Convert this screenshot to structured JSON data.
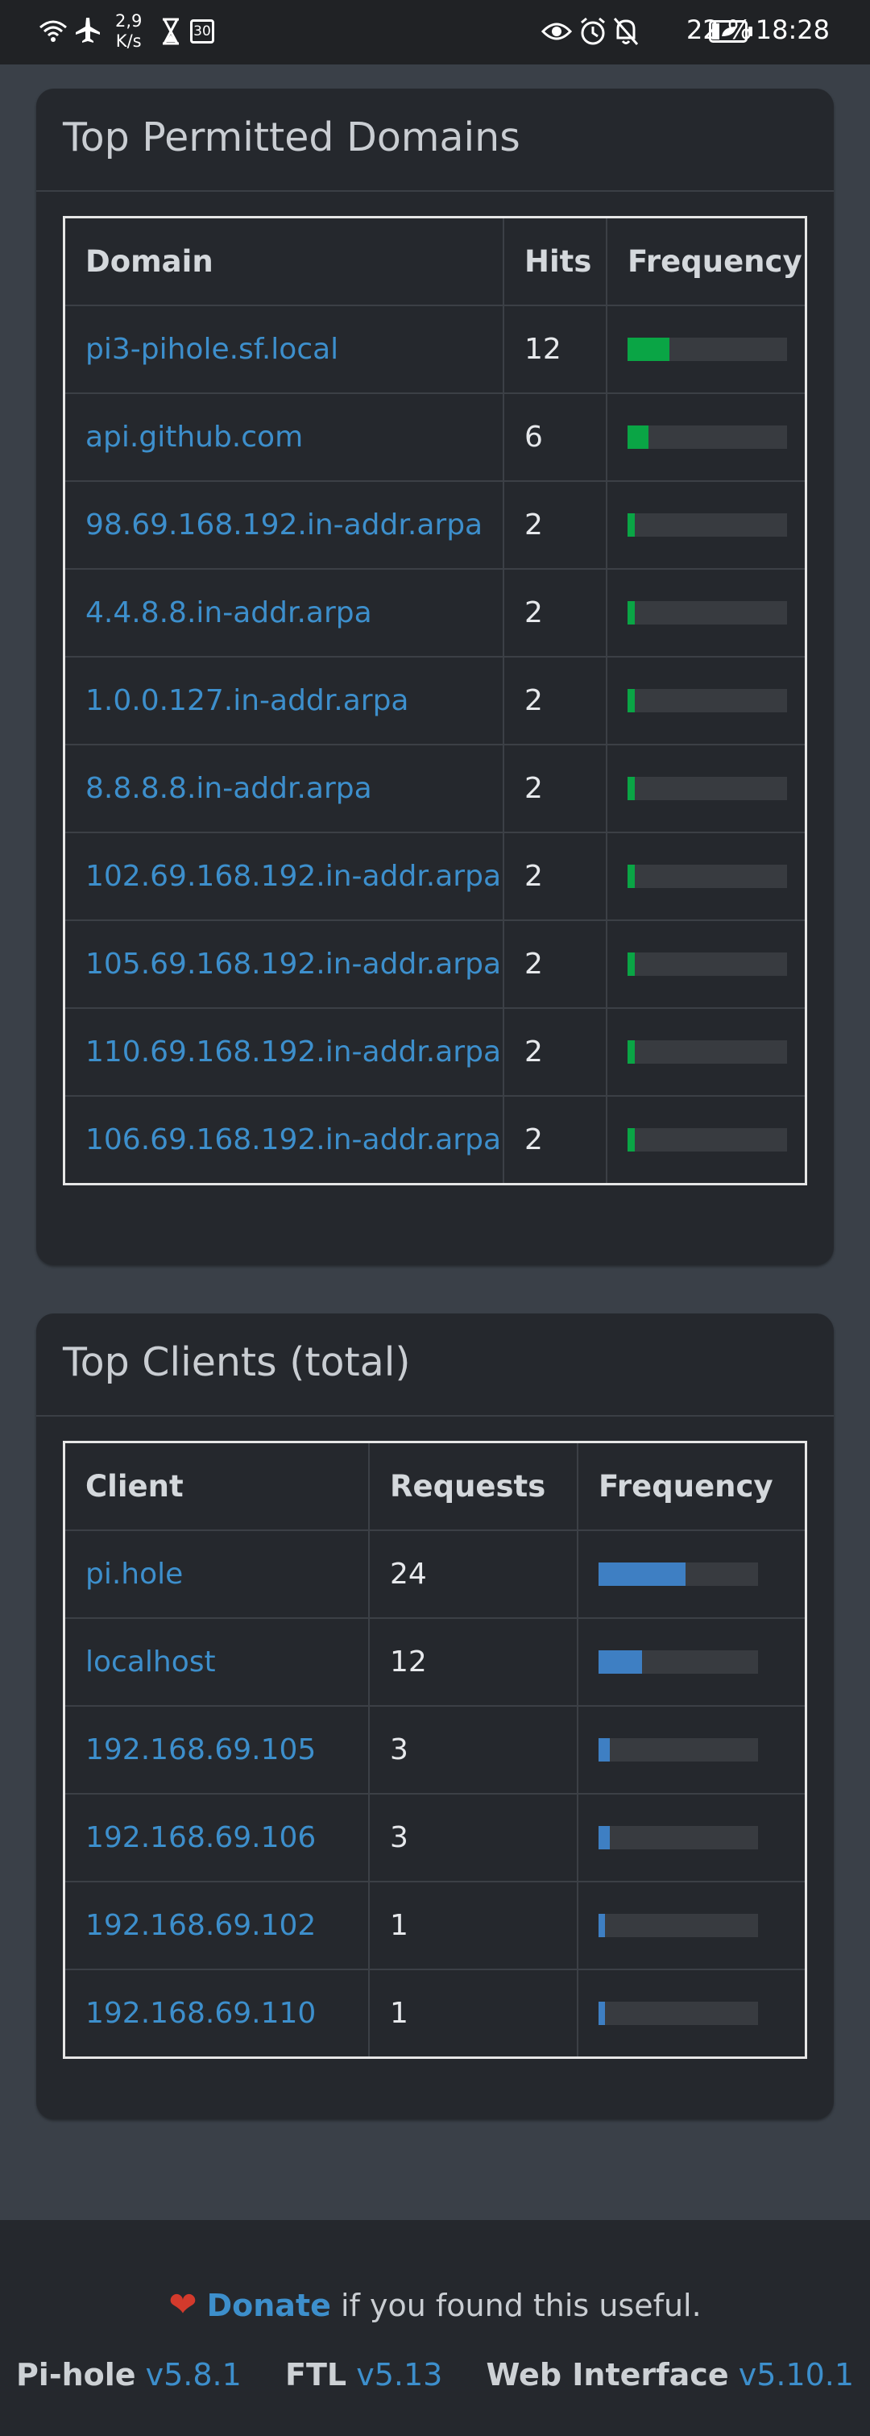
{
  "status_bar": {
    "speed_value": "2,9",
    "speed_unit": "K/s",
    "date_icon_text": "30",
    "battery_percent": "22 %",
    "time": "18:28"
  },
  "permitted": {
    "title": "Top Permitted Domains",
    "headers": [
      "Domain",
      "Hits",
      "Frequency"
    ],
    "rows": [
      {
        "domain": "pi3-pihole.sf.local",
        "hits": "12",
        "frequency": 0.2609
      },
      {
        "domain": "api.github.com",
        "hits": "6",
        "frequency": 0.1304
      },
      {
        "domain": "98.69.168.192.in-addr.arpa",
        "hits": "2",
        "frequency": 0.0435
      },
      {
        "domain": "4.4.8.8.in-addr.arpa",
        "hits": "2",
        "frequency": 0.0435
      },
      {
        "domain": "1.0.0.127.in-addr.arpa",
        "hits": "2",
        "frequency": 0.0435
      },
      {
        "domain": "8.8.8.8.in-addr.arpa",
        "hits": "2",
        "frequency": 0.0435
      },
      {
        "domain": "102.69.168.192.in-addr.arpa",
        "hits": "2",
        "frequency": 0.0435
      },
      {
        "domain": "105.69.168.192.in-addr.arpa",
        "hits": "2",
        "frequency": 0.0435
      },
      {
        "domain": "110.69.168.192.in-addr.arpa",
        "hits": "2",
        "frequency": 0.0435
      },
      {
        "domain": "106.69.168.192.in-addr.arpa",
        "hits": "2",
        "frequency": 0.0435
      }
    ],
    "bar_color": "#0aa545"
  },
  "clients": {
    "title": "Top Clients (total)",
    "headers": [
      "Client",
      "Requests",
      "Frequency"
    ],
    "rows": [
      {
        "client": "pi.hole",
        "requests": "24",
        "frequency": 0.5455
      },
      {
        "client": "localhost",
        "requests": "12",
        "frequency": 0.2727
      },
      {
        "client": "192.168.69.105",
        "requests": "3",
        "frequency": 0.0682
      },
      {
        "client": "192.168.69.106",
        "requests": "3",
        "frequency": 0.0682
      },
      {
        "client": "192.168.69.102",
        "requests": "1",
        "frequency": 0.0227
      },
      {
        "client": "192.168.69.110",
        "requests": "1",
        "frequency": 0.0227
      }
    ],
    "bar_color": "#3e7fc3"
  },
  "footer": {
    "donate_link": "Donate",
    "donate_text": " if you found this useful.",
    "versions": [
      {
        "name": "Pi-hole",
        "version": "v5.8.1"
      },
      {
        "name": "FTL",
        "version": "v5.13"
      },
      {
        "name": "Web Interface",
        "version": "v5.10.1"
      }
    ]
  }
}
